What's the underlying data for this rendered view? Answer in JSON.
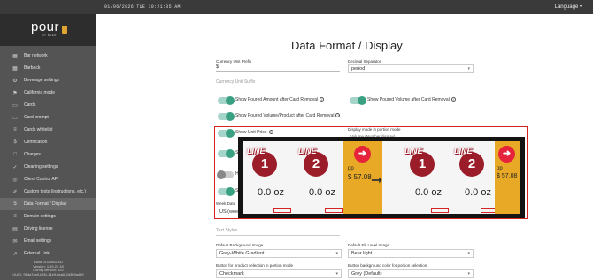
{
  "topbar": {
    "datetime": "01/06/2026 TUE    10:21:05 AM",
    "language": "Language ▾"
  },
  "sidebar": {
    "logo": "pour",
    "logo_sub": "MY BEER",
    "items": [
      {
        "label": "Bar network",
        "icon": "▦"
      },
      {
        "label": "Barback",
        "icon": "▦"
      },
      {
        "label": "Beverage settings",
        "icon": "⚙"
      },
      {
        "label": "California mode",
        "icon": "⚑"
      },
      {
        "label": "Cards",
        "icon": "▭"
      },
      {
        "label": "Card prompt",
        "icon": "▭"
      },
      {
        "label": "Cards whitelist",
        "icon": "≡"
      },
      {
        "label": "Certification",
        "icon": "$"
      },
      {
        "label": "Charges",
        "icon": "□"
      },
      {
        "label": "Cleaning settings",
        "icon": "✓"
      },
      {
        "label": "Client Control API",
        "icon": "◎"
      },
      {
        "label": "Custom texts (instructions, etc.)",
        "icon": "✐"
      },
      {
        "label": "Data Format / Display",
        "icon": "$"
      },
      {
        "label": "Domain settings",
        "icon": "≡"
      },
      {
        "label": "Driving license",
        "icon": "▤"
      },
      {
        "label": "Email settings",
        "icon": "✉"
      },
      {
        "label": "External Link",
        "icon": "⇗"
      }
    ],
    "build": [
      "Build: 20250626/D",
      "Version: 1.49.21.18",
      "Config version: 322",
      "UUID: 95da7ca9-b5f1-11e9-bea0-2d3b9a4b9"
    ]
  },
  "main": {
    "title": "Data Format / Display",
    "currency_prefix_label": "Currency Unit Prefix",
    "currency_prefix_value": "$",
    "currency_suffix_placeholder": "Currency Unit Suffix",
    "decimal_sep_label": "Decimal Separator",
    "decimal_sep_value": "period",
    "toggles": [
      {
        "label": "Show Poured Amount after Card Removal",
        "on": true
      },
      {
        "label": "Show Poured Volume after Card Removal",
        "on": true
      },
      {
        "label": "Show Poured Volume/Product after Card Removal",
        "on": true
      },
      {
        "label": "Show Unit Price",
        "on": true
      },
      {
        "label": "Sh",
        "on": true
      },
      {
        "label": "Hi",
        "on": false
      },
      {
        "label": "Sh",
        "on": true
      }
    ],
    "portion_mode_label": "Display mode in portion mode",
    "portion_mode_value": "Volume (Number display)",
    "week_date_label": "Week Date",
    "week_date_value": "US (week",
    "text_style_placeholder": "Text Styles",
    "bg_image_label": "Default Background Image",
    "bg_image_value": "Grey-White Gradient",
    "fill_image_label": "Default Fill Level Image",
    "fill_image_value": "Beer light",
    "btn_product_label": "Button for product selection in portion mode",
    "btn_product_value": "Checkmark",
    "btn_bg_label": "Button background color for portion selection",
    "btn_bg_value": "Grey (Default)"
  },
  "overlay": {
    "line_word": "LINE",
    "tap1_num": "1",
    "tap2_num": "2",
    "amount": "0.0 oz",
    "pp": "pp",
    "price": "$ 57.08",
    "arrow": "➞"
  }
}
